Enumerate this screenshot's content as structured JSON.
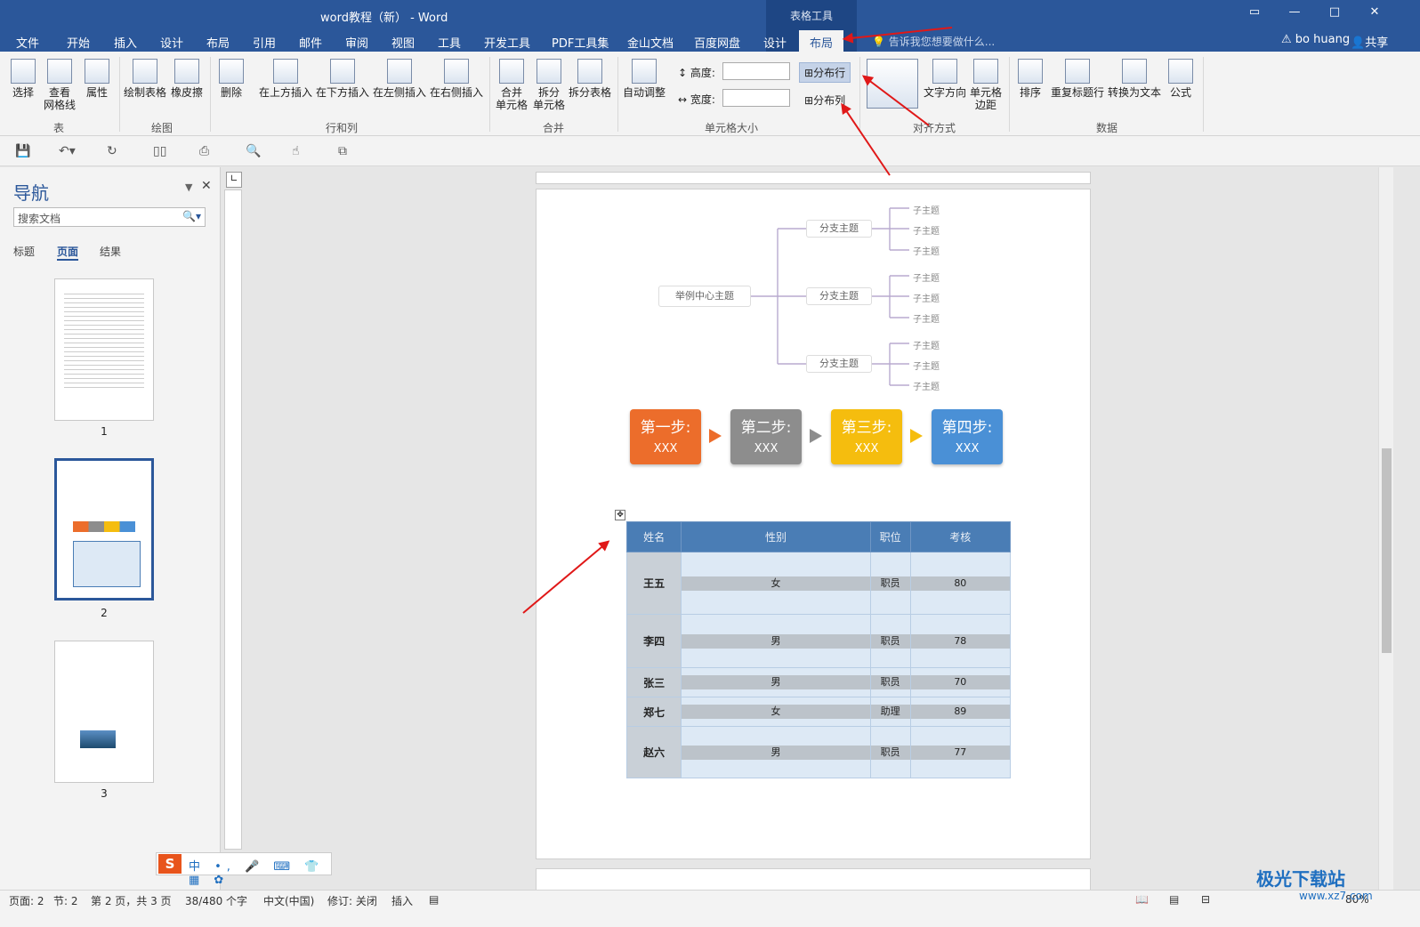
{
  "window": {
    "doc_title": "word教程（新） - Word",
    "context_group": "表格工具",
    "user": "bo huang",
    "share": "共享",
    "tell_me": "告诉我您想要做什么..."
  },
  "tabs": [
    "文件",
    "开始",
    "插入",
    "设计",
    "布局",
    "引用",
    "邮件",
    "审阅",
    "视图",
    "工具",
    "开发工具",
    "PDF工具集",
    "金山文档",
    "百度网盘",
    "设计",
    "布局"
  ],
  "active_tab": "布局",
  "ribbon": {
    "table_group": {
      "label": "表",
      "buttons": [
        "选择",
        "查看\n网格线",
        "属性"
      ]
    },
    "draw_group": {
      "label": "绘图",
      "buttons": [
        "绘制表格",
        "橡皮擦"
      ]
    },
    "rowcol_group": {
      "label": "行和列",
      "buttons": [
        "删除",
        "在上方插入",
        "在下方插入",
        "在左侧插入",
        "在右侧插入"
      ]
    },
    "merge_group": {
      "label": "合并",
      "buttons": [
        "合并\n单元格",
        "拆分\n单元格",
        "拆分表格"
      ]
    },
    "cellsize_group": {
      "label": "单元格大小",
      "autofit": "自动调整",
      "height_label": "高度:",
      "width_label": "宽度:",
      "dist_rows": "分布行",
      "dist_cols": "分布列"
    },
    "align_group": {
      "label": "对齐方式",
      "text_dir": "文字方向",
      "cell_margin": "单元格\n边距"
    },
    "data_group": {
      "label": "数据",
      "buttons": [
        "排序",
        "重复标题行",
        "转换为文本",
        "公式"
      ]
    }
  },
  "nav": {
    "title": "导航",
    "search_placeholder": "搜索文档",
    "tabs": [
      "标题",
      "页面",
      "结果"
    ],
    "active_tab": "页面",
    "pages": [
      "1",
      "2",
      "3"
    ]
  },
  "mindmap": {
    "center": "举例中心主题",
    "branches": [
      "分支主题",
      "分支主题",
      "分支主题"
    ],
    "sub": "子主题"
  },
  "steps": [
    {
      "label": "第一步:",
      "value": "XXX",
      "color": "#ec6d2b"
    },
    {
      "label": "第二步:",
      "value": "XXX",
      "color": "#8d8d8d"
    },
    {
      "label": "第三步:",
      "value": "XXX",
      "color": "#f5bd0e"
    },
    {
      "label": "第四步:",
      "value": "XXX",
      "color": "#4a90d6"
    }
  ],
  "table": {
    "headers": [
      "姓名",
      "性别",
      "职位",
      "考核"
    ],
    "rows": [
      [
        "王五",
        "女",
        "职员",
        "80"
      ],
      [
        "李四",
        "男",
        "职员",
        "78"
      ],
      [
        "张三",
        "男",
        "职员",
        "70"
      ],
      [
        "郑七",
        "女",
        "助理",
        "89"
      ],
      [
        "赵六",
        "男",
        "职员",
        "77"
      ]
    ]
  },
  "status": {
    "page": "页面: 2",
    "section": "节: 2",
    "pages": "第 2 页，共 3 页",
    "words": "38/480 个字",
    "lang": "中文(中国)",
    "track": "修订: 关闭",
    "mode": "插入",
    "zoom": "80%"
  },
  "watermark": {
    "text": "极光下载站",
    "url": "www.xz7.com"
  }
}
